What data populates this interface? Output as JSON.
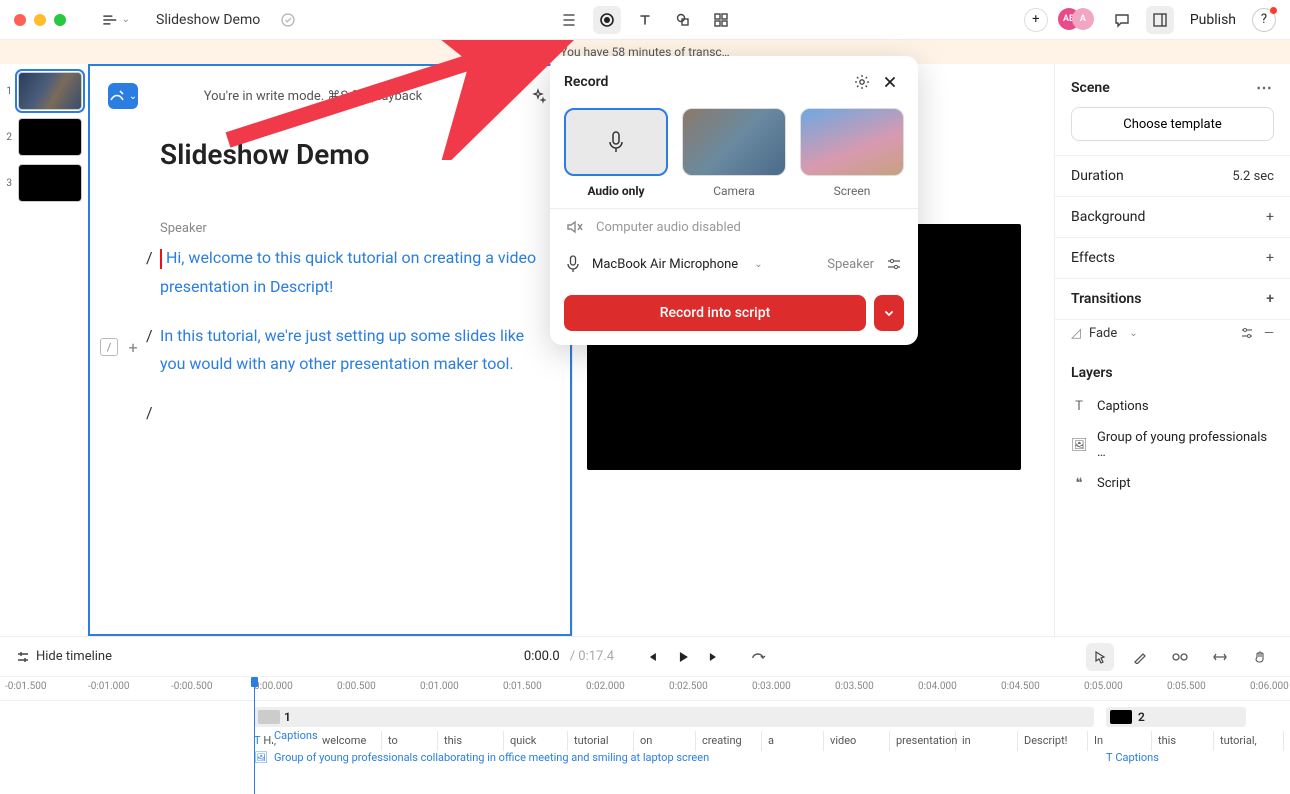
{
  "titlebar": {
    "project_name": "Slideshow Demo",
    "publish": "Publish",
    "avatars": [
      "AB",
      "A"
    ]
  },
  "notice": "You have 58 minutes of transc…",
  "thumbs": [
    "1",
    "2",
    "3"
  ],
  "script": {
    "mode_text": "You're in write mode. ⌘S for playback",
    "title": "Slideshow Demo",
    "speaker_label": "Speaker",
    "p1": "Hi, welcome to this quick tutorial  on creating a video presentation in Descript!",
    "p2": "In this tutorial, we're just setting up some slides like you would with any other presentation maker tool."
  },
  "record": {
    "title": "Record",
    "opt_audio": "Audio only",
    "opt_camera": "Camera",
    "opt_screen": "Screen",
    "computer_audio": "Computer audio disabled",
    "mic": "MacBook Air Microphone",
    "speaker_label": "Speaker",
    "button": "Record into script"
  },
  "sidebar": {
    "scene": "Scene",
    "choose": "Choose template",
    "duration_label": "Duration",
    "duration_value": "5.2 sec",
    "background": "Background",
    "effects": "Effects",
    "transitions": "Transitions",
    "fade": "Fade",
    "layers": "Layers",
    "layer_captions": "Captions",
    "layer_image": "Group of young professionals …",
    "layer_script": "Script"
  },
  "timeline": {
    "hide": "Hide timeline",
    "current": "0:00.0",
    "total": "0:17.4",
    "ticks": [
      "-0:01.500",
      "-0:01.000",
      "-0:00.500",
      "0:00.000",
      "0:00.500",
      "0:01.000",
      "0:01.500",
      "0:02.000",
      "0:02.500",
      "0:03.000",
      "0:03.500",
      "0:04.000",
      "0:04.500",
      "0:05.000",
      "0:05.500",
      "0:06.000"
    ],
    "clip1": "1",
    "clip2": "2",
    "captions_badge": "Captions",
    "hi": "Hi,",
    "words": [
      "welcome",
      "to",
      "this",
      "quick",
      "tutorial",
      "on",
      "creating",
      "a",
      "video",
      "presentation",
      "in",
      "Descript!",
      "In",
      "this",
      "tutorial,"
    ],
    "asset": "Group of young professionals collaborating in office meeting and smiling at laptop screen",
    "captions2": "Captions"
  }
}
